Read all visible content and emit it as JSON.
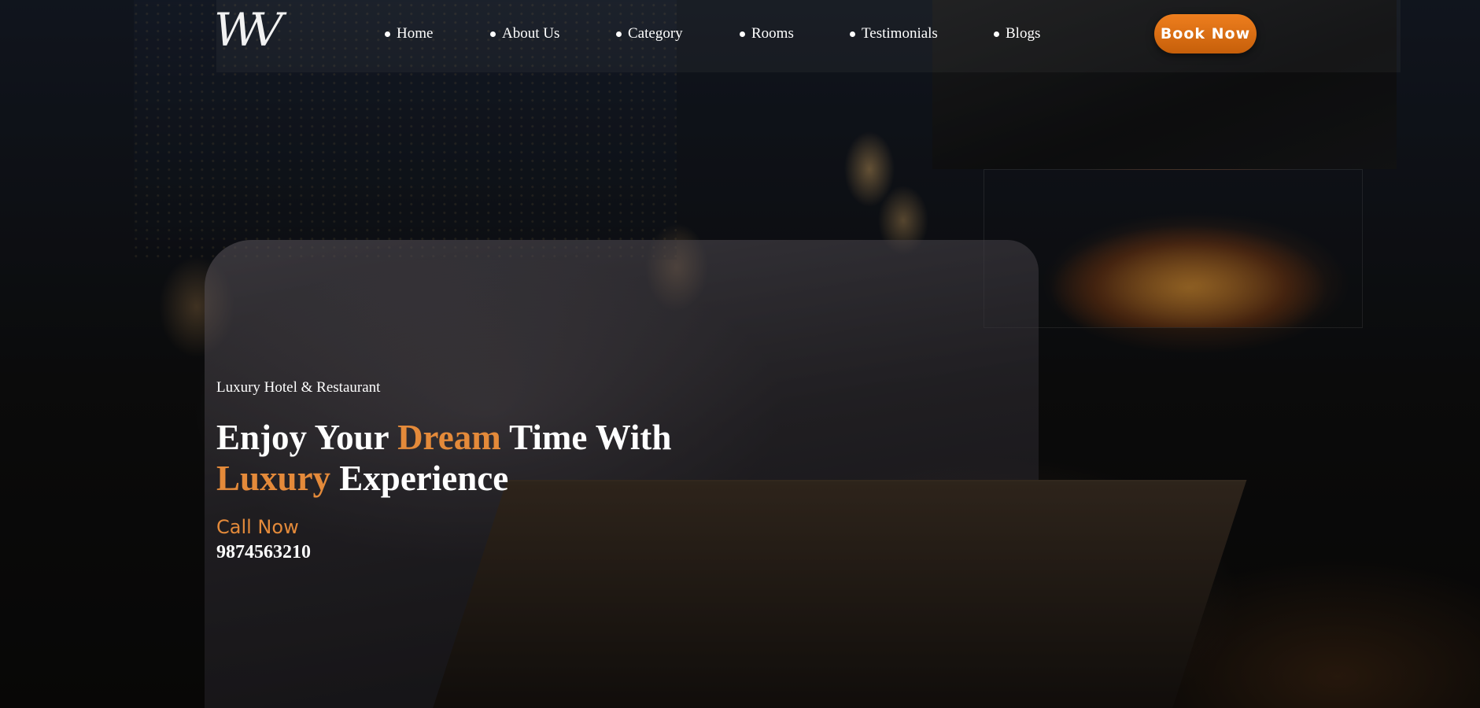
{
  "brand": {
    "logo_text": "WV"
  },
  "nav": {
    "items": [
      {
        "label": "Home"
      },
      {
        "label": "About Us"
      },
      {
        "label": "Category"
      },
      {
        "label": "Rooms"
      },
      {
        "label": "Testimonials"
      },
      {
        "label": "Blogs"
      }
    ]
  },
  "header": {
    "book_label": "Book Now"
  },
  "hero": {
    "eyebrow": "Luxury Hotel & Restaurant",
    "headline": {
      "w1": "Enjoy Your ",
      "w2": "Dream",
      "w3": " Time With",
      "w4": "Luxury",
      "w5": " Experience"
    },
    "call_label": "Call Now",
    "phone": "9874563210"
  },
  "colors": {
    "accent": "#e48a3a",
    "button": "#d9700f",
    "text": "#ffffff"
  }
}
